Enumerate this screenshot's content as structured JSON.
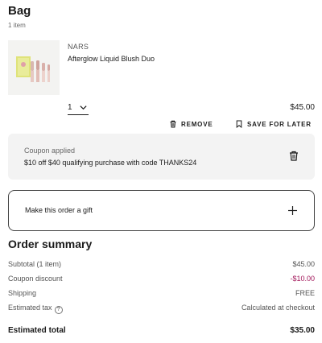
{
  "bag": {
    "title": "Bag",
    "item_count": "1 item"
  },
  "item": {
    "brand": "NARS",
    "name": "Afterglow Liquid Blush Duo",
    "quantity": "1",
    "price": "$45.00",
    "thumbnail": "blush-duo-product-image",
    "remove_label": "REMOVE",
    "save_label": "SAVE FOR LATER"
  },
  "coupon": {
    "label": "Coupon applied",
    "text": "$10 off $40 qualifying purchase with code THANKS24"
  },
  "gift": {
    "label": "Make this order a gift"
  },
  "summary": {
    "title": "Order summary",
    "rows": [
      {
        "label": "Subtotal (1 item)",
        "value": "$45.00"
      },
      {
        "label": "Coupon discount",
        "value": "-$10.00"
      },
      {
        "label": "Shipping",
        "value": "FREE"
      },
      {
        "label": "Estimated tax",
        "value": "Calculated at checkout"
      }
    ],
    "help_glyph": "?",
    "total_label": "Estimated total",
    "total_value": "$35.00"
  },
  "colors": {
    "discount": "#a2175a",
    "coupon_bg": "#f3f3f3"
  }
}
